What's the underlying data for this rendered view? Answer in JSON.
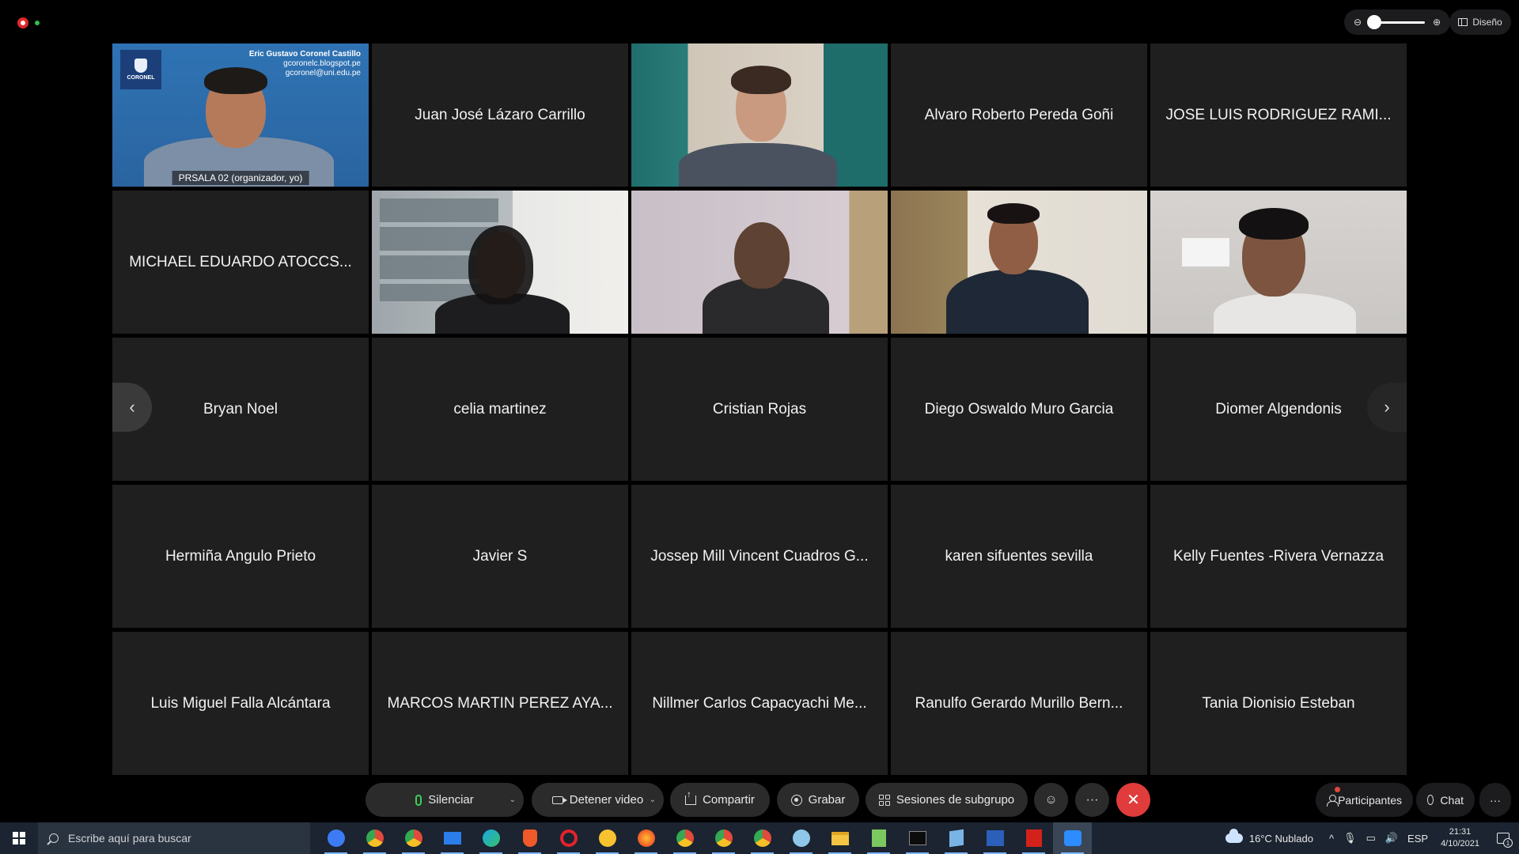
{
  "top_bar": {
    "layout_label": "Diseño",
    "zoom_out_icon": "zoom-out-icon",
    "zoom_in_icon": "zoom-in-icon",
    "zoom_level": 0.08
  },
  "presenter_tile": {
    "overlay_name": "Eric Gustavo Coronel Castillo",
    "overlay_line1": "gcoronelc.blogspot.pe",
    "overlay_line2": "gcoronel@uni.edu.pe",
    "logo_text": "CORONEL",
    "label": "PRSALA 02  (organizador, yo)"
  },
  "participants": [
    {
      "name": "Juan José Lázaro Carrillo",
      "video": false
    },
    {
      "name": "",
      "video": true
    },
    {
      "name": "Alvaro Roberto Pereda Goñi",
      "video": false
    },
    {
      "name": "JOSE LUIS RODRIGUEZ RAMI...",
      "video": false
    },
    {
      "name": "MICHAEL EDUARDO ATOCCS...",
      "video": false
    },
    {
      "name": "",
      "video": true
    },
    {
      "name": "",
      "video": true
    },
    {
      "name": "",
      "video": true
    },
    {
      "name": "",
      "video": true
    },
    {
      "name": "Bryan Noel",
      "video": false
    },
    {
      "name": "celia martinez",
      "video": false
    },
    {
      "name": "Cristian Rojas",
      "video": false
    },
    {
      "name": "Diego Oswaldo Muro Garcia",
      "video": false
    },
    {
      "name": "Diomer Algendonis",
      "video": false
    },
    {
      "name": "Hermiña Angulo Prieto",
      "video": false
    },
    {
      "name": "Javier S",
      "video": false
    },
    {
      "name": "Jossep Mill Vincent Cuadros G...",
      "video": false
    },
    {
      "name": "karen sifuentes sevilla",
      "video": false
    },
    {
      "name": "Kelly Fuentes -Rivera Vernazza",
      "video": false
    },
    {
      "name": "Luis Miguel Falla Alcántara",
      "video": false
    },
    {
      "name": "MARCOS MARTIN PEREZ AYA...",
      "video": false
    },
    {
      "name": "Nillmer Carlos Capacyachi Me...",
      "video": false
    },
    {
      "name": "Ranulfo Gerardo Murillo Bern...",
      "video": false
    },
    {
      "name": "Tania Dionisio Esteban",
      "video": false
    }
  ],
  "controls": {
    "mute": "Silenciar",
    "stop_video": "Detener video",
    "share": "Compartir",
    "record": "Grabar",
    "breakout": "Sesiones de subgrupo",
    "participants": "Participantes",
    "chat": "Chat"
  },
  "taskbar": {
    "search_placeholder": "Escribe aquí para buscar",
    "weather": "16°C  Nublado",
    "language": "ESP",
    "time": "21:31",
    "date": "4/10/2021",
    "notification_count": "1"
  }
}
